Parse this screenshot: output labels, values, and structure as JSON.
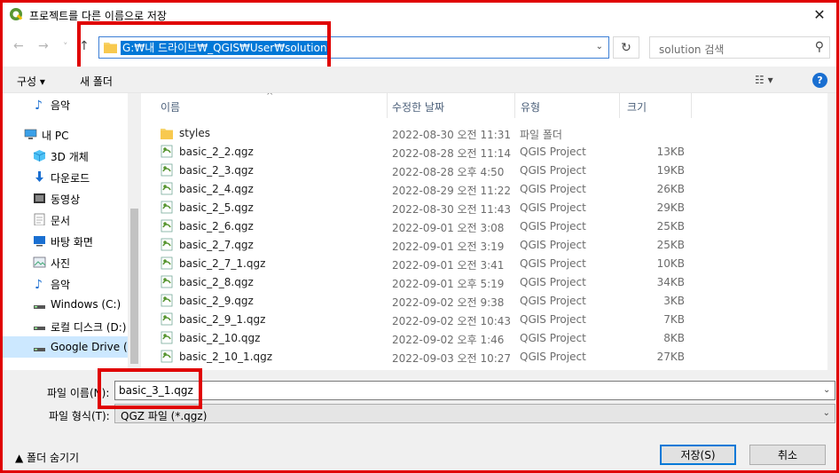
{
  "window": {
    "title": "프로젝트를 다른 이름으로 저장",
    "close": "✕"
  },
  "nav": {
    "back": "←",
    "forward": "→",
    "recent": "˅",
    "up": "↑",
    "address": "G:₩내 드라이브₩_QGIS₩User₩solution",
    "refresh": "↻",
    "search_placeholder": "solution 검색"
  },
  "toolbar": {
    "organize": "구성 ▾",
    "new_folder": "새 폴더",
    "view": "☷ ▾",
    "help": "?"
  },
  "sidebar": {
    "items": [
      {
        "label": "음악",
        "icon": "music-icon",
        "indent": 1
      },
      {
        "label": "내 PC",
        "icon": "computer-icon",
        "indent": 0
      },
      {
        "label": "3D 개체",
        "icon": "3d-objects-icon",
        "indent": 1
      },
      {
        "label": "다운로드",
        "icon": "download-icon",
        "indent": 1
      },
      {
        "label": "동영상",
        "icon": "video-icon",
        "indent": 1
      },
      {
        "label": "문서",
        "icon": "document-icon",
        "indent": 1
      },
      {
        "label": "바탕 화면",
        "icon": "desktop-icon",
        "indent": 1
      },
      {
        "label": "사진",
        "icon": "pictures-icon",
        "indent": 1
      },
      {
        "label": "음악",
        "icon": "music-icon",
        "indent": 1
      },
      {
        "label": "Windows (C:)",
        "icon": "drive-icon",
        "indent": 1
      },
      {
        "label": "로컬 디스크 (D:)",
        "icon": "drive-icon",
        "indent": 1
      },
      {
        "label": "Google Drive (G",
        "icon": "drive-icon",
        "indent": 1
      }
    ]
  },
  "columns": {
    "name": "이름",
    "date": "수정한 날짜",
    "type": "유형",
    "size": "크기"
  },
  "files": [
    {
      "name": "styles",
      "date": "2022-08-30 오전 11:31",
      "type": "파일 폴더",
      "size": "",
      "kind": "folder"
    },
    {
      "name": "basic_2_2.qgz",
      "date": "2022-08-28 오전 11:14",
      "type": "QGIS Project",
      "size": "13KB",
      "kind": "qgz"
    },
    {
      "name": "basic_2_3.qgz",
      "date": "2022-08-28 오후 4:50",
      "type": "QGIS Project",
      "size": "19KB",
      "kind": "qgz"
    },
    {
      "name": "basic_2_4.qgz",
      "date": "2022-08-29 오전 11:22",
      "type": "QGIS Project",
      "size": "26KB",
      "kind": "qgz"
    },
    {
      "name": "basic_2_5.qgz",
      "date": "2022-08-30 오전 11:43",
      "type": "QGIS Project",
      "size": "29KB",
      "kind": "qgz"
    },
    {
      "name": "basic_2_6.qgz",
      "date": "2022-09-01 오전 3:08",
      "type": "QGIS Project",
      "size": "25KB",
      "kind": "qgz"
    },
    {
      "name": "basic_2_7.qgz",
      "date": "2022-09-01 오전 3:19",
      "type": "QGIS Project",
      "size": "25KB",
      "kind": "qgz"
    },
    {
      "name": "basic_2_7_1.qgz",
      "date": "2022-09-01 오전 3:41",
      "type": "QGIS Project",
      "size": "10KB",
      "kind": "qgz"
    },
    {
      "name": "basic_2_8.qgz",
      "date": "2022-09-01 오후 5:19",
      "type": "QGIS Project",
      "size": "34KB",
      "kind": "qgz"
    },
    {
      "name": "basic_2_9.qgz",
      "date": "2022-09-02 오전 9:38",
      "type": "QGIS Project",
      "size": "3KB",
      "kind": "qgz"
    },
    {
      "name": "basic_2_9_1.qgz",
      "date": "2022-09-02 오전 10:43",
      "type": "QGIS Project",
      "size": "7KB",
      "kind": "qgz"
    },
    {
      "name": "basic_2_10.qgz",
      "date": "2022-09-02 오후 1:46",
      "type": "QGIS Project",
      "size": "8KB",
      "kind": "qgz"
    },
    {
      "name": "basic_2_10_1.qgz",
      "date": "2022-09-03 오전 10:27",
      "type": "QGIS Project",
      "size": "27KB",
      "kind": "qgz"
    }
  ],
  "bottom": {
    "filename_label": "파일 이름(N):",
    "filename_value": "basic_3_1.qgz",
    "filetype_label": "파일 형식(T):",
    "filetype_value": "QGZ 파일 (*.qgz)",
    "hide_folders": "▲  폴더 숨기기",
    "save": "저장(S)",
    "cancel": "취소"
  },
  "colors": {
    "highlight": "#e00000",
    "accent": "#0078d7",
    "selected_nav": "#cce8ff"
  }
}
